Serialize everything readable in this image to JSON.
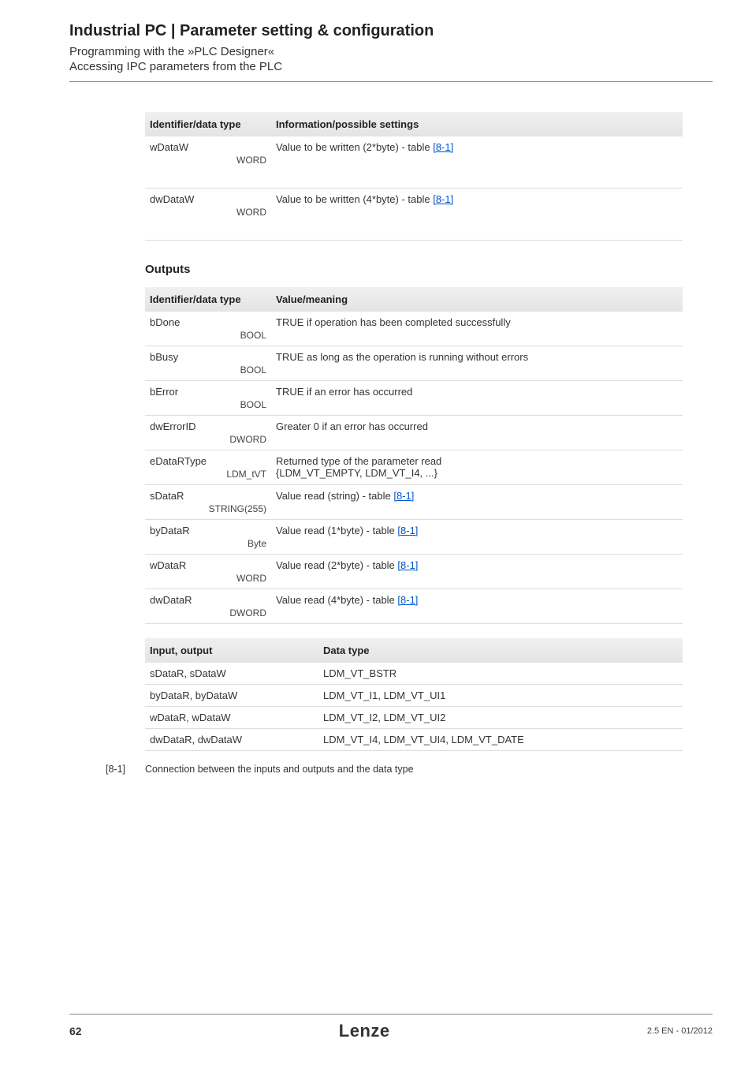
{
  "header": {
    "title": "Industrial PC | Parameter setting & configuration",
    "sub1": "Programming with the »PLC Designer«",
    "sub2": "Accessing IPC parameters from the PLC"
  },
  "inputs_table": {
    "h1": "Identifier/data type",
    "h2": "Information/possible settings",
    "rows": [
      {
        "name": "wDataW",
        "type": "WORD",
        "info_pre": "Value to be written  (2*byte) - table ",
        "link": "[8-1]"
      },
      {
        "name": "dwDataW",
        "type": "WORD",
        "info_pre": "Value to be written  (4*byte) - table ",
        "link": "[8-1]"
      }
    ]
  },
  "outputs_heading": "Outputs",
  "outputs_table": {
    "h1": "Identifier/data type",
    "h2": "Value/meaning",
    "rows": [
      {
        "name": "bDone",
        "type": "BOOL",
        "info": "TRUE if operation has been completed successfully"
      },
      {
        "name": "bBusy",
        "type": "BOOL",
        "info": "TRUE as long as the operation is running without errors"
      },
      {
        "name": "bError",
        "type": "BOOL",
        "info": "TRUE if an error has occurred"
      },
      {
        "name": "dwErrorID",
        "type": "DWORD",
        "info": "Greater 0 if an error has occurred"
      },
      {
        "name": "eDataRType",
        "type": "LDM_tVT",
        "info": "Returned type of the parameter read\n{LDM_VT_EMPTY, LDM_VT_I4, ...}"
      },
      {
        "name": "sDataR",
        "type": "STRING(255)",
        "info_pre": "Value read (string) - table ",
        "link": "[8-1]"
      },
      {
        "name": "byDataR",
        "type": "Byte",
        "info_pre": "Value read (1*byte) - table ",
        "link": "[8-1]"
      },
      {
        "name": "wDataR",
        "type": "WORD",
        "info_pre": "Value read (2*byte) - table ",
        "link": "[8-1]"
      },
      {
        "name": "dwDataR",
        "type": "DWORD",
        "info_pre": "Value read (4*byte) - table ",
        "link": "[8-1]"
      }
    ]
  },
  "io_table": {
    "h1": "Input, output",
    "h2": "Data type",
    "rows": [
      {
        "c1": "sDataR, sDataW",
        "c2": "LDM_VT_BSTR"
      },
      {
        "c1": "byDataR, byDataW",
        "c2": "LDM_VT_I1, LDM_VT_UI1"
      },
      {
        "c1": "wDataR, wDataW",
        "c2": "LDM_VT_I2, LDM_VT_UI2"
      },
      {
        "c1": "dwDataR, dwDataW",
        "c2": "LDM_VT_I4, LDM_VT_UI4, LDM_VT_DATE"
      }
    ]
  },
  "caption": {
    "tag": "[8-1]",
    "text": "Connection between the inputs and outputs and the data type"
  },
  "footer": {
    "page": "62",
    "brand": "Lenze",
    "ver": "2.5 EN - 01/2012"
  }
}
